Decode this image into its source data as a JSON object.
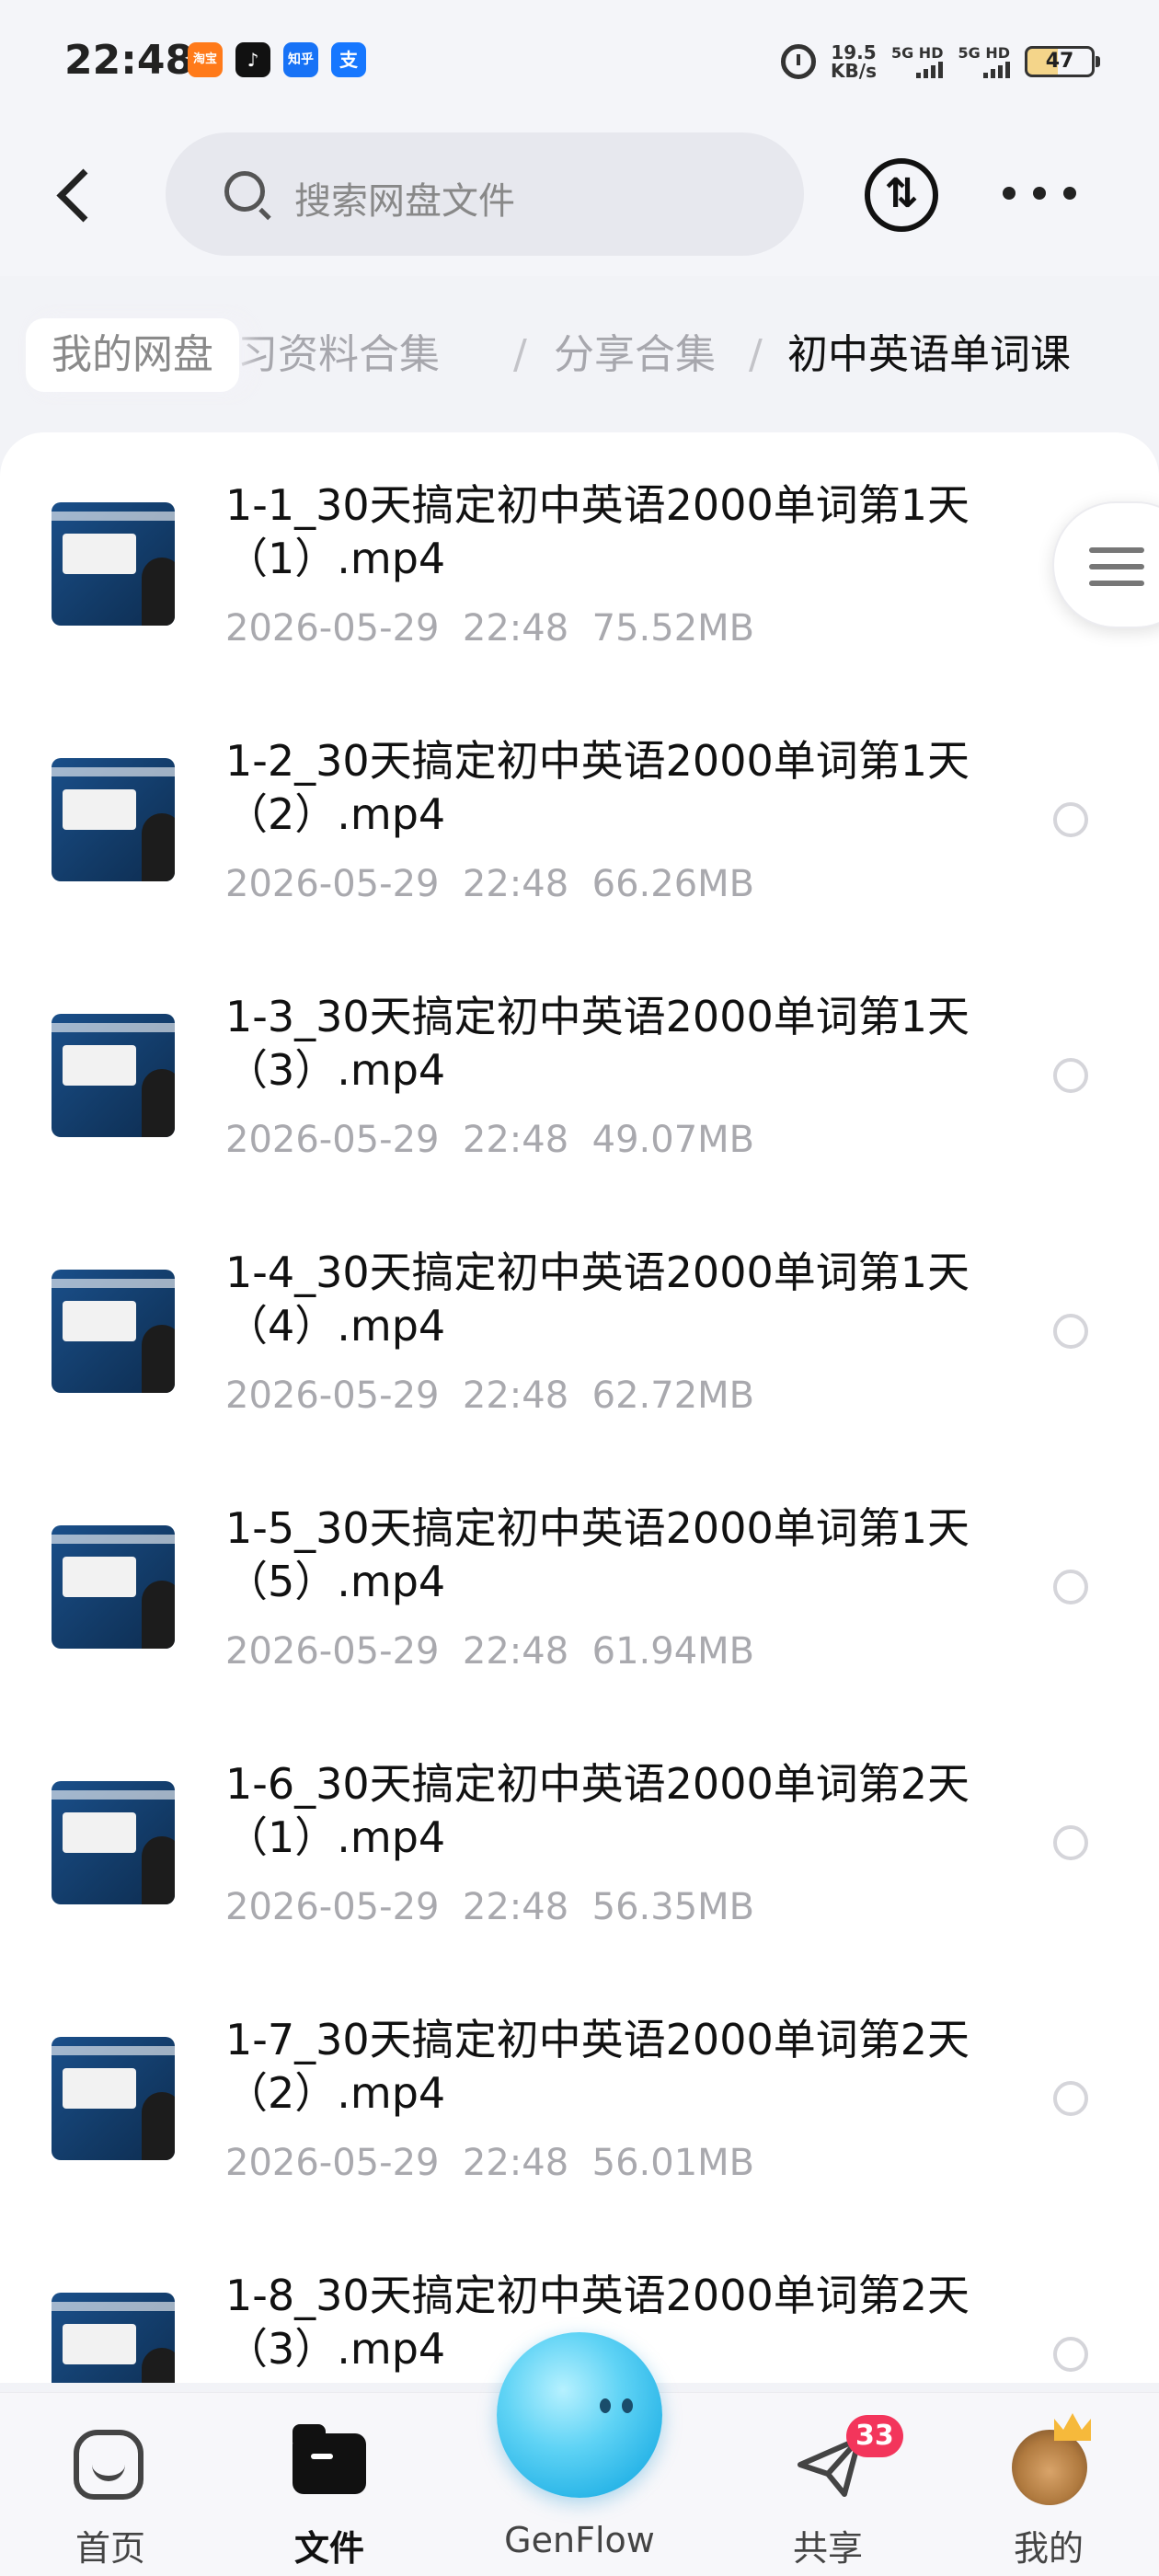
{
  "status_bar": {
    "time": "22:48",
    "net_speed_value": "19.5",
    "net_speed_unit": "KB/s",
    "signal1": "5G HD",
    "signal2": "5G HD",
    "battery": "47",
    "app_icons": [
      {
        "name": "taobao-icon",
        "label": "淘宝",
        "color": "#ff7a1a"
      },
      {
        "name": "tiktok-icon",
        "label": "♪",
        "color": "#111111"
      },
      {
        "name": "zhihu-icon",
        "label": "知乎",
        "color": "#1772f6"
      },
      {
        "name": "alipay-icon",
        "label": "支",
        "color": "#1677ff"
      }
    ]
  },
  "search": {
    "placeholder": "搜索网盘文件"
  },
  "breadcrumb": {
    "home": "我的网盘",
    "items": [
      "学习资料合集",
      "分享合集",
      "初中英语单词课"
    ]
  },
  "files": [
    {
      "name": "1-1_30天搞定初中英语2000单词第1天（1）.mp4",
      "date": "2026-05-29",
      "time": "22:48",
      "size": "75.52MB"
    },
    {
      "name": "1-2_30天搞定初中英语2000单词第1天（2）.mp4",
      "date": "2026-05-29",
      "time": "22:48",
      "size": "66.26MB"
    },
    {
      "name": "1-3_30天搞定初中英语2000单词第1天（3）.mp4",
      "date": "2026-05-29",
      "time": "22:48",
      "size": "49.07MB"
    },
    {
      "name": "1-4_30天搞定初中英语2000单词第1天（4）.mp4",
      "date": "2026-05-29",
      "time": "22:48",
      "size": "62.72MB"
    },
    {
      "name": "1-5_30天搞定初中英语2000单词第1天（5）.mp4",
      "date": "2026-05-29",
      "time": "22:48",
      "size": "61.94MB"
    },
    {
      "name": "1-6_30天搞定初中英语2000单词第2天（1）.mp4",
      "date": "2026-05-29",
      "time": "22:48",
      "size": "56.35MB"
    },
    {
      "name": "1-7_30天搞定初中英语2000单词第2天（2）.mp4",
      "date": "2026-05-29",
      "time": "22:48",
      "size": "56.01MB"
    },
    {
      "name": "1-8_30天搞定初中英语2000单词第2天（3）.mp4",
      "date": "",
      "time": "",
      "size": ""
    }
  ],
  "nav": {
    "home": "首页",
    "files": "文件",
    "genflow": "GenFlow",
    "share": "共享",
    "share_badge": "33",
    "mine": "我的"
  }
}
